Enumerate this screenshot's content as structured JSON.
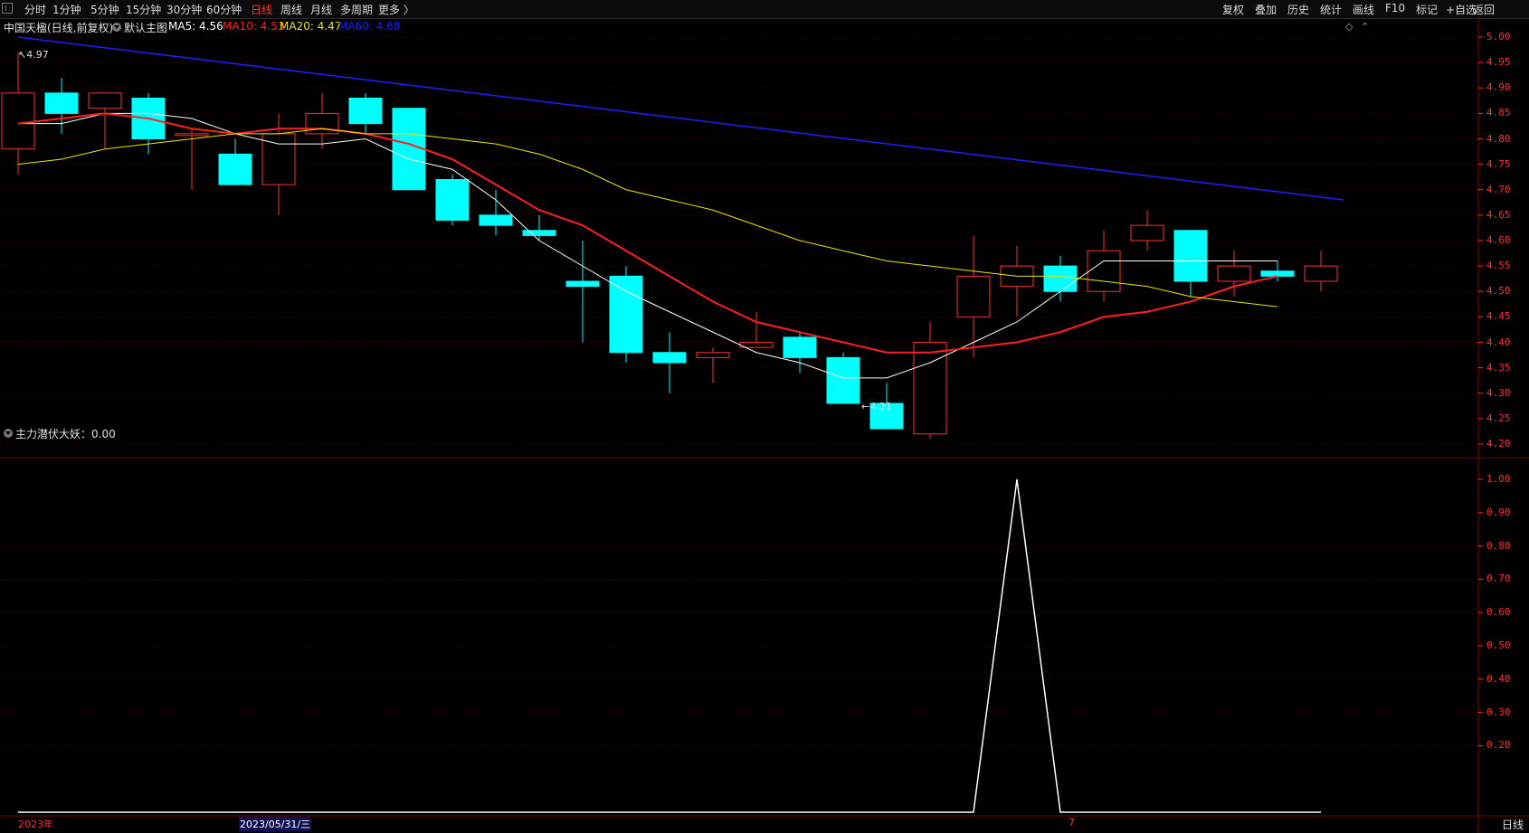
{
  "toolbar": {
    "periods": [
      "分时",
      "1分钟",
      "5分钟",
      "15分钟",
      "30分钟",
      "60分钟",
      "日线",
      "周线",
      "月线",
      "多周期",
      "更多 〉"
    ],
    "active_period": "日线",
    "right_items": [
      "复权",
      "叠加",
      "历史",
      "统计",
      "画线",
      "F10",
      "标记",
      "+自选",
      "返回"
    ]
  },
  "main_info": {
    "stock": "中国天楹(日线,前复权)",
    "template": "默认主图",
    "ma5_label": "MA5: 4.56",
    "ma10_label": "MA10: 4.53",
    "ma20_label": "MA20: 4.47",
    "ma60_label": "MA60: 4.68"
  },
  "sub_info": {
    "indicator": "主力潜伏大妖：0.00"
  },
  "annotations": {
    "high": "4.97",
    "low": "4.21"
  },
  "footer": {
    "year": "2023年",
    "cursor_date": "2023/05/31/三",
    "month_mark": "7",
    "period": "日线"
  },
  "colors": {
    "up": "#ff3030",
    "down": "#00ffff",
    "ma5": "#ffffff",
    "ma10": "#ff2020",
    "ma20": "#e8e800",
    "ma60": "#2020ff",
    "axis": "#ff3030"
  },
  "chart_data": [
    {
      "type": "candlestick",
      "title": "中国天楹(日线,前复权)",
      "y_ticks": [
        "5.00",
        "4.95",
        "4.90",
        "4.85",
        "4.80",
        "4.75",
        "4.70",
        "4.65",
        "4.60",
        "4.55",
        "4.50",
        "4.45",
        "4.40",
        "4.35",
        "4.30",
        "4.25",
        "4.20"
      ],
      "ylim": [
        4.18,
        5.02
      ],
      "candles": [
        {
          "o": 4.78,
          "h": 4.97,
          "l": 4.73,
          "c": 4.89
        },
        {
          "o": 4.89,
          "h": 4.92,
          "l": 4.81,
          "c": 4.85
        },
        {
          "o": 4.86,
          "h": 4.89,
          "l": 4.78,
          "c": 4.89
        },
        {
          "o": 4.88,
          "h": 4.89,
          "l": 4.77,
          "c": 4.8
        },
        {
          "o": 4.81,
          "h": 4.82,
          "l": 4.7,
          "c": 4.81
        },
        {
          "o": 4.77,
          "h": 4.8,
          "l": 4.71,
          "c": 4.71
        },
        {
          "o": 4.71,
          "h": 4.85,
          "l": 4.65,
          "c": 4.81
        },
        {
          "o": 4.81,
          "h": 4.89,
          "l": 4.78,
          "c": 4.85
        },
        {
          "o": 4.88,
          "h": 4.89,
          "l": 4.81,
          "c": 4.83
        },
        {
          "o": 4.86,
          "h": 4.86,
          "l": 4.7,
          "c": 4.7
        },
        {
          "o": 4.72,
          "h": 4.73,
          "l": 4.63,
          "c": 4.64
        },
        {
          "o": 4.65,
          "h": 4.7,
          "l": 4.61,
          "c": 4.63
        },
        {
          "o": 4.62,
          "h": 4.65,
          "l": 4.6,
          "c": 4.61
        },
        {
          "o": 4.52,
          "h": 4.6,
          "l": 4.4,
          "c": 4.51
        },
        {
          "o": 4.53,
          "h": 4.55,
          "l": 4.36,
          "c": 4.38
        },
        {
          "o": 4.38,
          "h": 4.42,
          "l": 4.3,
          "c": 4.36
        },
        {
          "o": 4.37,
          "h": 4.39,
          "l": 4.32,
          "c": 4.38
        },
        {
          "o": 4.39,
          "h": 4.46,
          "l": 4.39,
          "c": 4.4
        },
        {
          "o": 4.41,
          "h": 4.42,
          "l": 4.34,
          "c": 4.37
        },
        {
          "o": 4.37,
          "h": 4.38,
          "l": 4.28,
          "c": 4.28
        },
        {
          "o": 4.28,
          "h": 4.32,
          "l": 4.23,
          "c": 4.23
        },
        {
          "o": 4.22,
          "h": 4.44,
          "l": 4.21,
          "c": 4.4
        },
        {
          "o": 4.45,
          "h": 4.61,
          "l": 4.37,
          "c": 4.53
        },
        {
          "o": 4.51,
          "h": 4.59,
          "l": 4.45,
          "c": 4.55
        },
        {
          "o": 4.55,
          "h": 4.57,
          "l": 4.48,
          "c": 4.5
        },
        {
          "o": 4.5,
          "h": 4.62,
          "l": 4.48,
          "c": 4.58
        },
        {
          "o": 4.6,
          "h": 4.66,
          "l": 4.58,
          "c": 4.63
        },
        {
          "o": 4.62,
          "h": 4.62,
          "l": 4.49,
          "c": 4.52
        },
        {
          "o": 4.52,
          "h": 4.58,
          "l": 4.49,
          "c": 4.55
        },
        {
          "o": 4.54,
          "h": 4.56,
          "l": 4.52,
          "c": 4.53
        },
        {
          "o": 4.52,
          "h": 4.58,
          "l": 4.5,
          "c": 4.55
        }
      ],
      "series": [
        {
          "name": "MA5",
          "values": [
            4.83,
            4.83,
            4.85,
            4.85,
            4.84,
            4.81,
            4.79,
            4.79,
            4.8,
            4.76,
            4.74,
            4.68,
            4.6,
            4.55,
            4.5,
            4.46,
            4.42,
            4.38,
            4.36,
            4.33,
            4.33,
            4.36,
            4.4,
            4.44,
            4.5,
            4.56,
            4.56,
            4.56,
            4.56,
            4.56
          ]
        },
        {
          "name": "MA10",
          "values": [
            4.83,
            4.84,
            4.85,
            4.84,
            4.82,
            4.81,
            4.82,
            4.82,
            4.81,
            4.79,
            4.76,
            4.71,
            4.66,
            4.63,
            4.58,
            4.53,
            4.48,
            4.44,
            4.42,
            4.4,
            4.38,
            4.38,
            4.39,
            4.4,
            4.42,
            4.45,
            4.46,
            4.48,
            4.51,
            4.53
          ]
        },
        {
          "name": "MA20",
          "values": [
            4.75,
            4.76,
            4.78,
            4.79,
            4.8,
            4.81,
            4.81,
            4.82,
            4.81,
            4.81,
            4.8,
            4.79,
            4.77,
            4.74,
            4.7,
            4.68,
            4.66,
            4.63,
            4.6,
            4.58,
            4.56,
            4.55,
            4.54,
            4.53,
            4.53,
            4.52,
            4.51,
            4.49,
            4.48,
            4.47
          ]
        },
        {
          "name": "MA60",
          "values": [
            5.0,
            4.99,
            4.98,
            4.97,
            4.96,
            4.95,
            4.94,
            4.93,
            4.92,
            4.91,
            4.9,
            4.89,
            4.88,
            4.87,
            4.86,
            4.85,
            4.84,
            4.83,
            4.82,
            4.81,
            4.8,
            4.79,
            4.78,
            4.77,
            4.76,
            4.75,
            4.74,
            4.73,
            4.72,
            4.71,
            4.7,
            4.69,
            4.68
          ]
        }
      ]
    },
    {
      "type": "line",
      "title": "主力潜伏大妖：0.00",
      "y_ticks": [
        "1.00",
        "0.90",
        "0.80",
        "0.70",
        "0.60",
        "0.50",
        "0.40",
        "0.30",
        "0.20"
      ],
      "ylim": [
        0,
        1
      ],
      "series": [
        {
          "name": "主力潜伏大妖",
          "values": [
            0,
            0,
            0,
            0,
            0,
            0,
            0,
            0,
            0,
            0,
            0,
            0,
            0,
            0,
            0,
            0,
            0,
            0,
            0,
            0,
            0,
            0,
            0,
            1,
            0,
            0,
            0,
            0,
            0,
            0,
            0
          ]
        }
      ]
    }
  ]
}
